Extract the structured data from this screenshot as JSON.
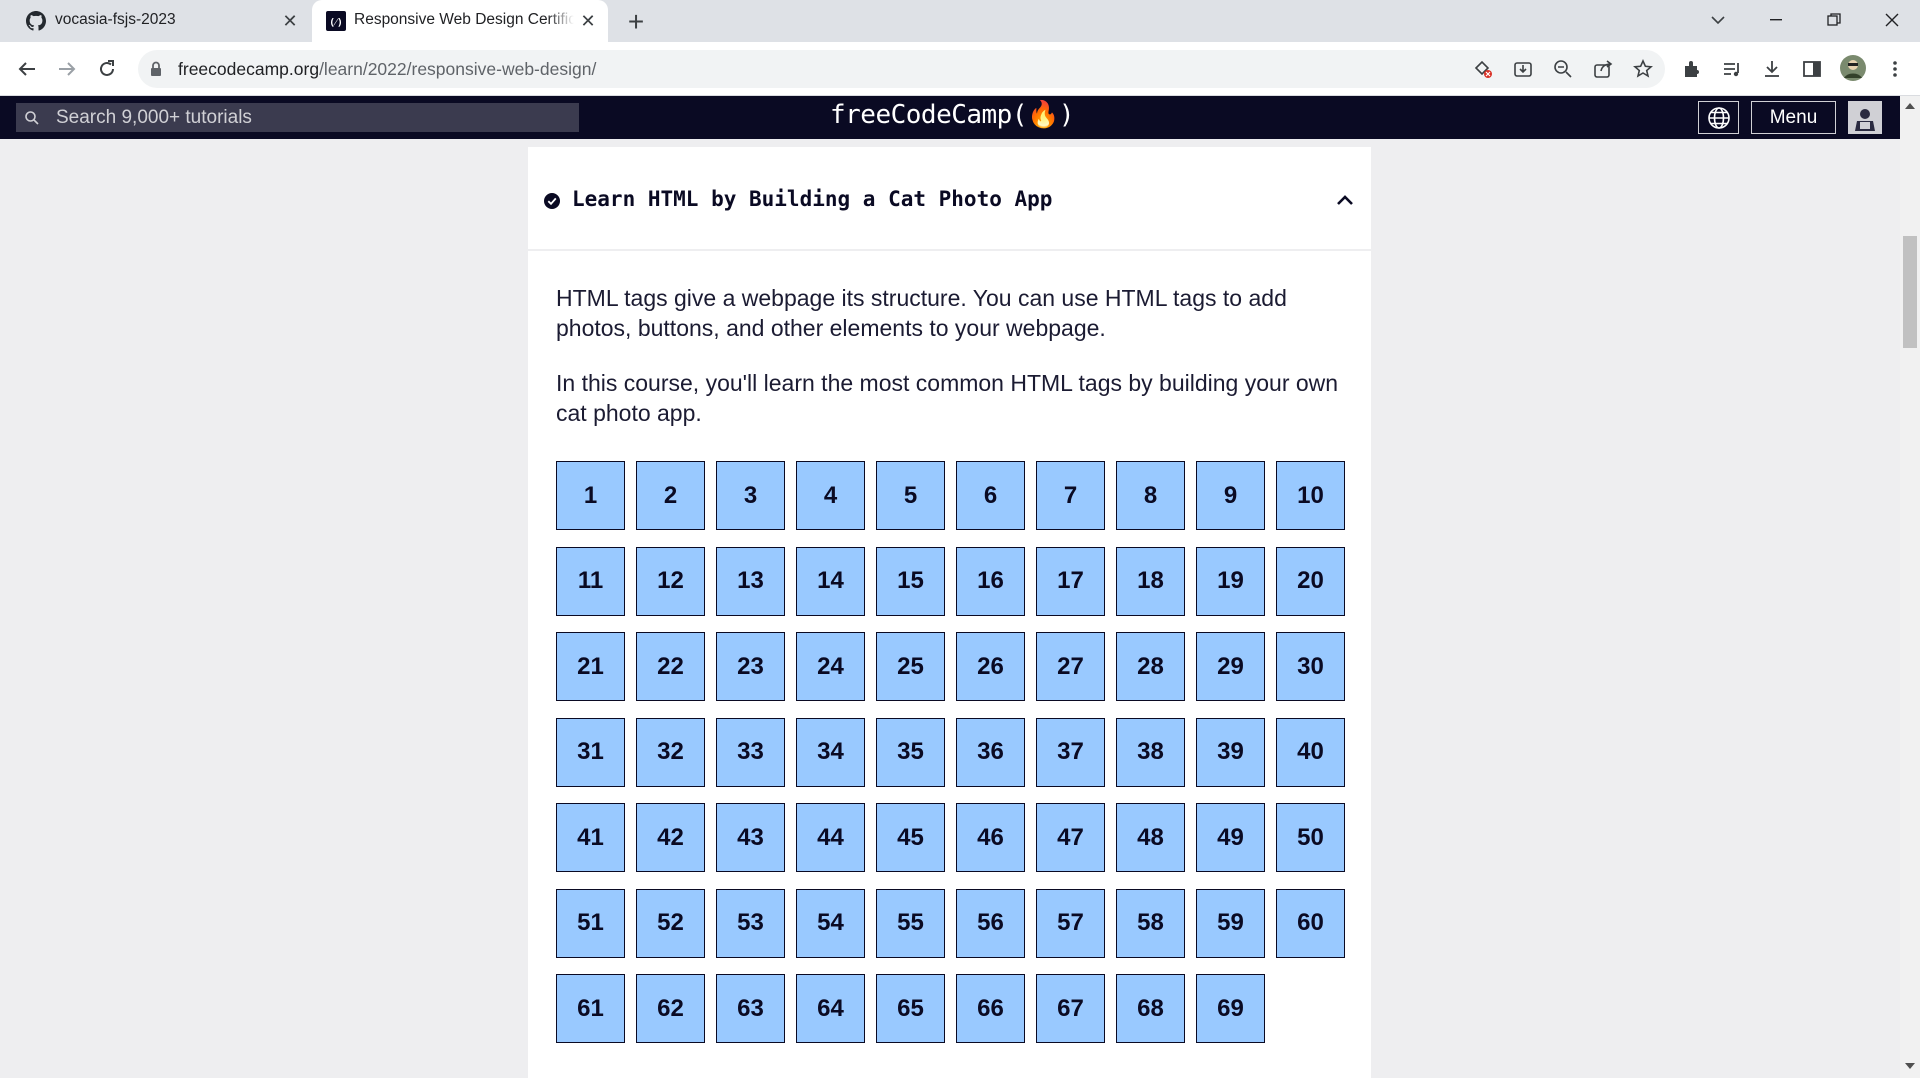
{
  "browser": {
    "tabs": [
      {
        "title": "vocasia-fsjs-2023",
        "icon": "github-icon"
      },
      {
        "title": "Responsive Web Design Certification",
        "icon": "freecodecamp-icon"
      }
    ],
    "url": {
      "domain": "freecodecamp.org",
      "path": "/learn/2022/responsive-web-design/"
    }
  },
  "navbar": {
    "search_placeholder": "Search 9,000+ tutorials",
    "logo": "freeCodeCamp(🔥)",
    "menu_label": "Menu"
  },
  "block": {
    "title": "Learn HTML by Building a Cat Photo App",
    "status": "completed",
    "expanded": true,
    "description": [
      "HTML tags give a webpage its structure. You can use HTML tags to add photos, buttons, and other elements to your webpage.",
      "In this course, you'll learn the most common HTML tags by building your own cat photo app."
    ],
    "steps": [
      "1",
      "2",
      "3",
      "4",
      "5",
      "6",
      "7",
      "8",
      "9",
      "10",
      "11",
      "12",
      "13",
      "14",
      "15",
      "16",
      "17",
      "18",
      "19",
      "20",
      "21",
      "22",
      "23",
      "24",
      "25",
      "26",
      "27",
      "28",
      "29",
      "30",
      "31",
      "32",
      "33",
      "34",
      "35",
      "36",
      "37",
      "38",
      "39",
      "40",
      "41",
      "42",
      "43",
      "44",
      "45",
      "46",
      "47",
      "48",
      "49",
      "50",
      "51",
      "52",
      "53",
      "54",
      "55",
      "56",
      "57",
      "58",
      "59",
      "60",
      "61",
      "62",
      "63",
      "64",
      "65",
      "66",
      "67",
      "68",
      "69"
    ]
  },
  "colors": {
    "nav_background": "#0a0a23",
    "step_fill": "#99c9ff",
    "page_background": "#eeeef0"
  }
}
